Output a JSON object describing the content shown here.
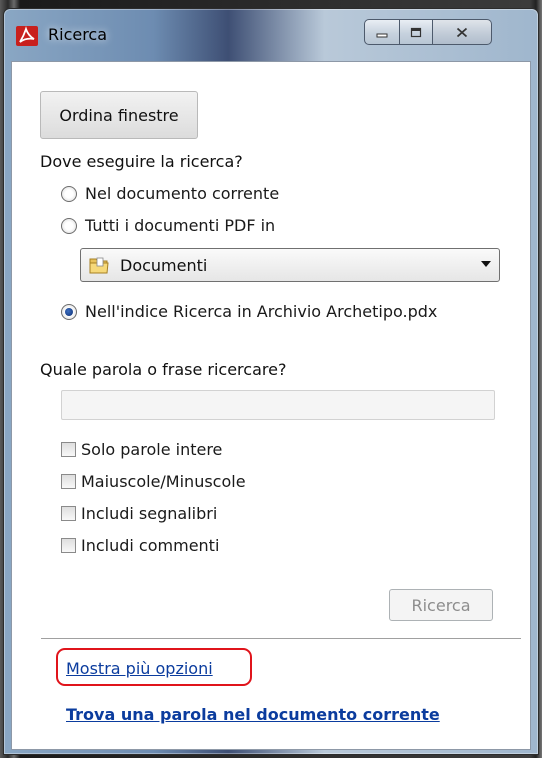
{
  "window": {
    "title": "Ricerca",
    "app_icon": "adobe-reader-icon",
    "caption": {
      "minimize": "minimize-icon",
      "maximize": "maximize-icon",
      "close": "close-icon"
    }
  },
  "toolbar": {
    "arrange_windows_label": "Ordina finestre"
  },
  "search_location": {
    "heading": "Dove eseguire la ricerca?",
    "options": [
      {
        "label": "Nel documento corrente",
        "checked": false
      },
      {
        "label": "Tutti i documenti PDF in",
        "checked": false
      },
      {
        "label": "Nell'indice Ricerca in Archivio Archetipo.pdx",
        "checked": true
      }
    ],
    "folder_select": {
      "value": "Documenti",
      "icon": "folder-icon"
    }
  },
  "search_term": {
    "heading": "Quale parola o frase ricercare?",
    "value": "",
    "placeholder": ""
  },
  "options": [
    {
      "label": "Solo parole intere",
      "checked": false
    },
    {
      "label": "Maiuscole/Minuscole",
      "checked": false
    },
    {
      "label": "Includi segnalibri",
      "checked": false
    },
    {
      "label": "Includi commenti",
      "checked": false
    }
  ],
  "actions": {
    "search_label": "Ricerca"
  },
  "links": {
    "more_options": "Mostra più opzioni",
    "find_in_current": "Trova una parola nel documento corrente"
  },
  "colors": {
    "highlight": "#e0141b",
    "link": "#0b3c9e",
    "app_icon": "#c8201d"
  }
}
